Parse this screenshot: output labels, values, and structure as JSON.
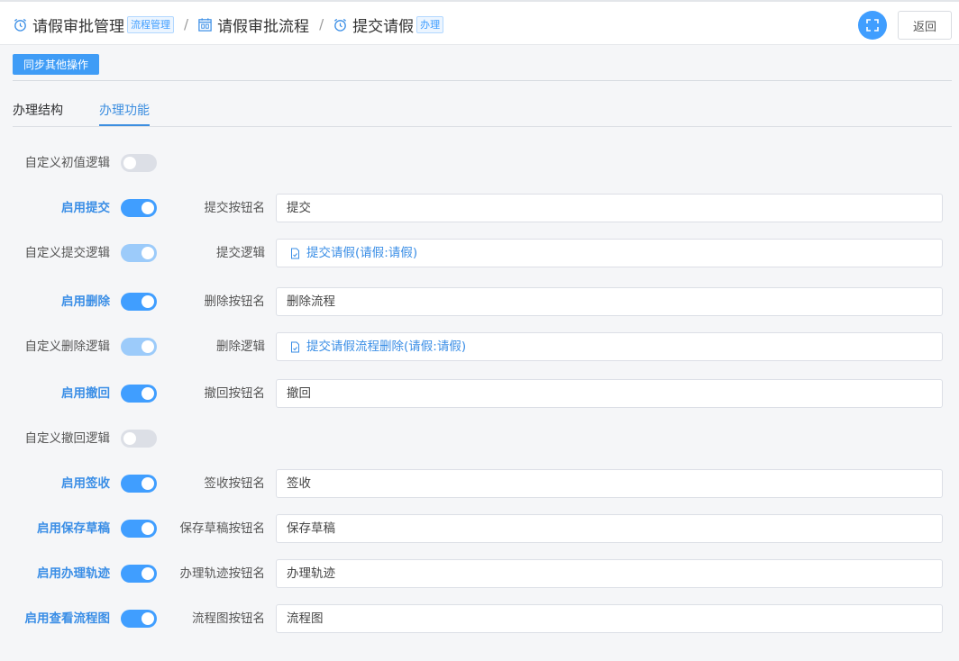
{
  "breadcrumb": [
    {
      "label": "请假审批管理",
      "tag": "流程管理",
      "icon": "alarm-clock-icon"
    },
    {
      "label": "请假审批流程",
      "tag": "",
      "icon": "calendar-icon"
    },
    {
      "label": "提交请假",
      "tag": "办理",
      "icon": "alarm-clock-icon"
    }
  ],
  "separator": "/",
  "header": {
    "back_label": "返回",
    "fullscreen_icon": "fullscreen-icon"
  },
  "toolbar": {
    "sync_label": "同步其他操作"
  },
  "tabs": {
    "structure": "办理结构",
    "function": "办理功能"
  },
  "colors": {
    "accent": "#409eff",
    "label_strong": "#3a8ee6"
  },
  "rows": {
    "custom_init": {
      "label": "自定义初值逻辑",
      "state": "off"
    },
    "enable_submit": {
      "label": "启用提交",
      "state": "on",
      "field_label": "提交按钮名",
      "value": "提交"
    },
    "custom_submit": {
      "label": "自定义提交逻辑",
      "state": "on",
      "field_label": "提交逻辑",
      "link": "提交请假(请假:请假)"
    },
    "enable_delete": {
      "label": "启用删除",
      "state": "on",
      "field_label": "删除按钮名",
      "value": "删除流程"
    },
    "custom_delete": {
      "label": "自定义删除逻辑",
      "state": "on",
      "field_label": "删除逻辑",
      "link": "提交请假流程删除(请假:请假)"
    },
    "enable_withdraw": {
      "label": "启用撤回",
      "state": "on",
      "field_label": "撤回按钮名",
      "value": "撤回"
    },
    "custom_withdraw": {
      "label": "自定义撤回逻辑",
      "state": "off"
    },
    "enable_signin": {
      "label": "启用签收",
      "state": "on",
      "field_label": "签收按钮名",
      "value": "签收"
    },
    "enable_draft": {
      "label": "启用保存草稿",
      "state": "on",
      "field_label": "保存草稿按钮名",
      "value": "保存草稿"
    },
    "enable_track": {
      "label": "启用办理轨迹",
      "state": "on",
      "field_label": "办理轨迹按钮名",
      "value": "办理轨迹"
    },
    "enable_flowchart": {
      "label": "启用查看流程图",
      "state": "on",
      "field_label": "流程图按钮名",
      "value": "流程图"
    }
  }
}
